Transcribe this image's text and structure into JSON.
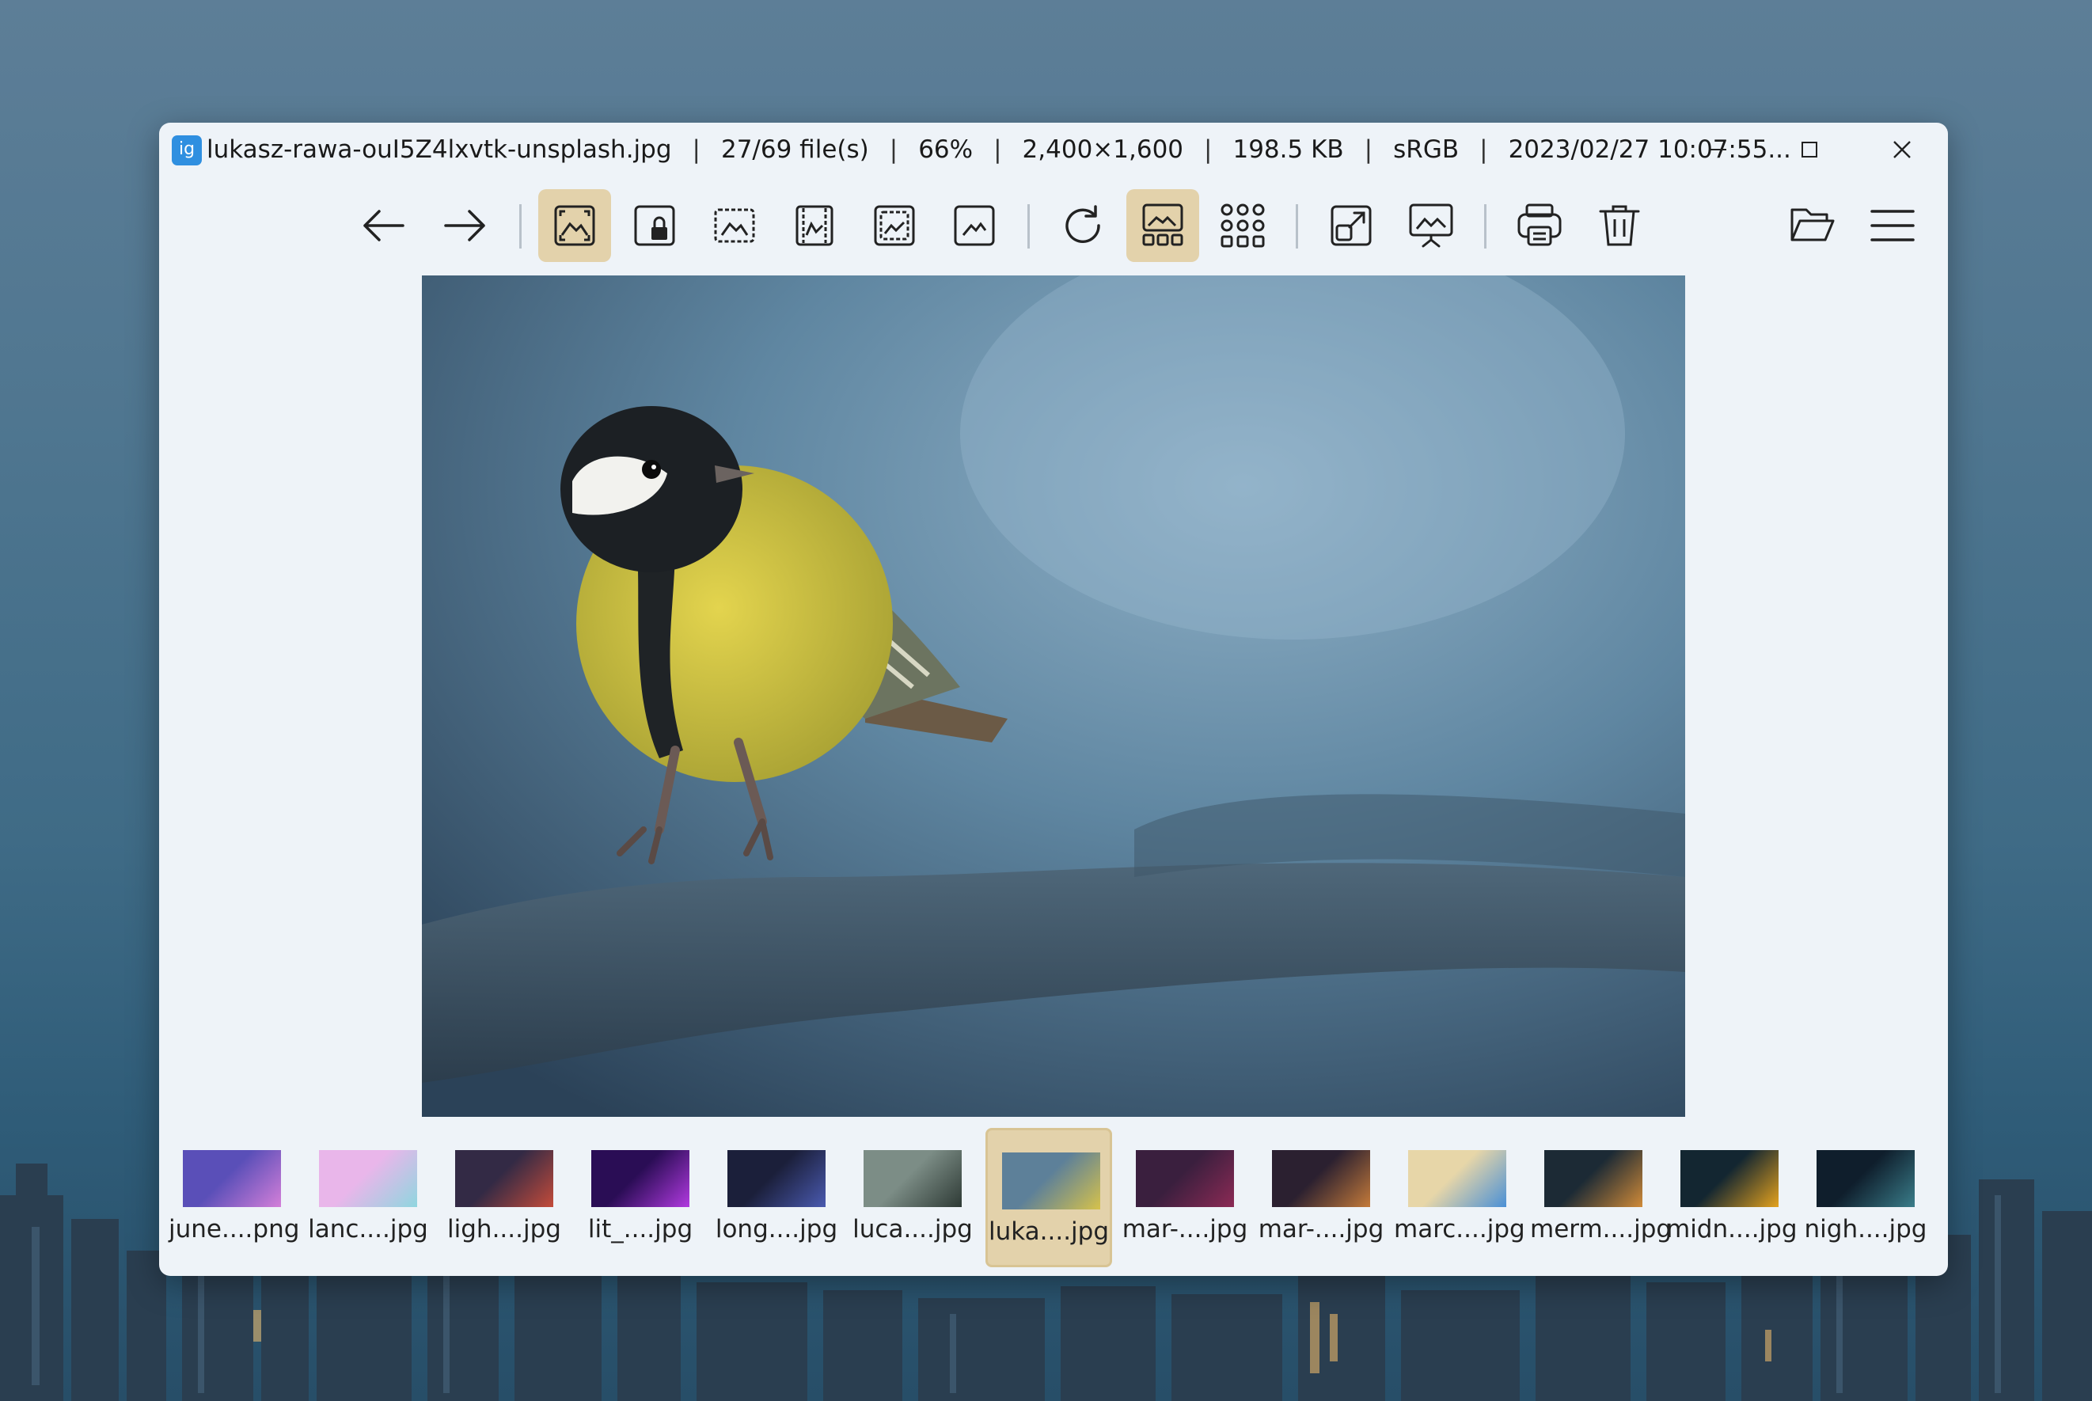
{
  "titlebar": {
    "app_icon_text": "ig",
    "filename": "lukasz-rawa-ouI5Z4lxvtk-unsplash.jpg",
    "file_index": "27/69 file(s)",
    "zoom": "66%",
    "dimensions": "2,400×1,600",
    "size": "198.5 KB",
    "color_profile": "sRGB",
    "datetime": "2023/02/27 10:07:55..."
  },
  "toolbar": {
    "buttons": [
      "back-arrow",
      "forward-arrow",
      "auto-zoom",
      "lock-zoom",
      "scale-to-width",
      "scale-to-height",
      "scale-to-fit",
      "scale-to-fill",
      "refresh",
      "thumbnail-bar",
      "gallery",
      "open-with",
      "slideshow",
      "print",
      "delete",
      "open-file",
      "main-menu"
    ]
  },
  "thumbnails": [
    {
      "label": "june....png",
      "active": false
    },
    {
      "label": "lanc....jpg",
      "active": false
    },
    {
      "label": "ligh....jpg",
      "active": false
    },
    {
      "label": "lit_....jpg",
      "active": false
    },
    {
      "label": "long....jpg",
      "active": false
    },
    {
      "label": "luca....jpg",
      "active": false
    },
    {
      "label": "luka....jpg",
      "active": true
    },
    {
      "label": "mar-....jpg",
      "active": false
    },
    {
      "label": "mar-....jpg",
      "active": false
    },
    {
      "label": "marc....jpg",
      "active": false
    },
    {
      "label": "merm....jpg",
      "active": false
    },
    {
      "label": "midn....jpg",
      "active": false
    },
    {
      "label": "nigh....jpg",
      "active": false
    }
  ],
  "colors": {
    "window_bg": "#eef3f8",
    "active_button": "#e3d2ab",
    "accent_icon": "#2f8fe0"
  }
}
